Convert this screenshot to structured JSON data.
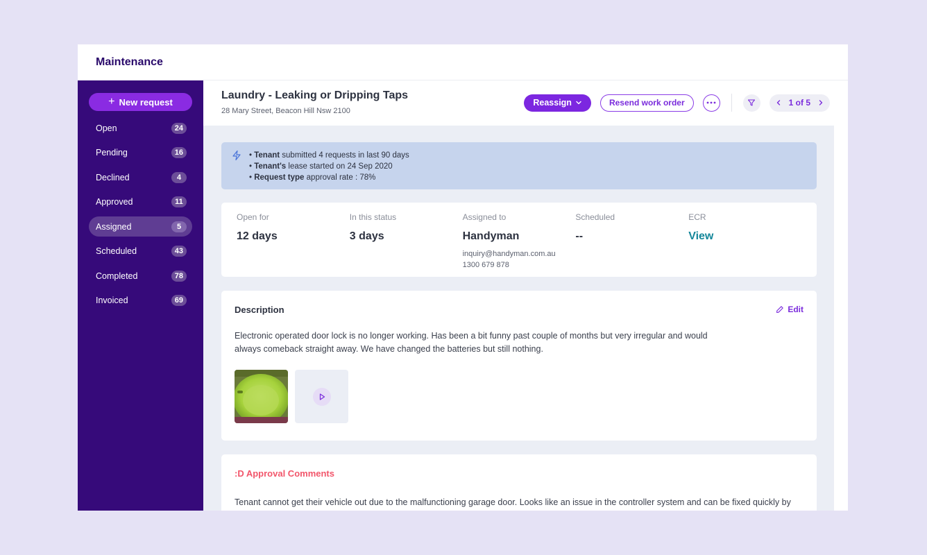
{
  "app": {
    "title": "Maintenance"
  },
  "sidebar": {
    "new_request_label": "New request",
    "items": [
      {
        "label": "Open",
        "count": "24"
      },
      {
        "label": "Pending",
        "count": "16"
      },
      {
        "label": "Declined",
        "count": "4"
      },
      {
        "label": "Approved",
        "count": "11"
      },
      {
        "label": "Assigned",
        "count": "5",
        "active": true
      },
      {
        "label": "Scheduled",
        "count": "43"
      },
      {
        "label": "Completed",
        "count": "78"
      },
      {
        "label": "Invoiced",
        "count": "69"
      }
    ]
  },
  "header": {
    "title": "Laundry - Leaking or Dripping Taps",
    "address": "28 Mary Street, Beacon Hill Nsw 2100",
    "reassign_label": "Reassign",
    "resend_label": "Resend work order",
    "more_icon": "more-horizontal-icon",
    "filter_icon": "filter-icon",
    "pager": {
      "text": "1 of 5"
    }
  },
  "alert": {
    "icon": "lightning-icon",
    "lines": [
      {
        "bold": "Tenant",
        "text": " submitted 4 requests in last 90 days"
      },
      {
        "bold": "Tenant's",
        "text": " lease started on 24 Sep 2020"
      },
      {
        "bold": "Request type",
        "text": " approval rate : 78%"
      }
    ]
  },
  "stats": {
    "open_for": {
      "label": "Open for",
      "value": "12 days"
    },
    "in_status": {
      "label": "In this status",
      "value": "3 days"
    },
    "assigned_to": {
      "label": "Assigned to",
      "value": "Handyman",
      "email": "inquiry@handyman.com.au",
      "phone": "1300 679 878"
    },
    "scheduled": {
      "label": "Scheduled",
      "value": "--"
    },
    "ecr": {
      "label": "ECR",
      "value": "View"
    }
  },
  "description": {
    "title": "Description",
    "edit_label": "Edit",
    "text": "Electronic operated door lock is no longer working. Has been a bit funny past couple of months but very irregular and would always comeback straight away. We have changed the batteries but still nothing."
  },
  "comments": {
    "title": ":D Approval Comments",
    "text": "Tenant cannot get their vehicle out due to the malfunctioning garage door. Looks like an issue in the controller system and can be fixed quickly by"
  },
  "colors": {
    "sidebar_bg": "#360a7a",
    "accent": "#7c27e0",
    "link_teal": "#14879a",
    "alert_bg": "#c6d4ed",
    "comments_title": "#f2566b"
  }
}
